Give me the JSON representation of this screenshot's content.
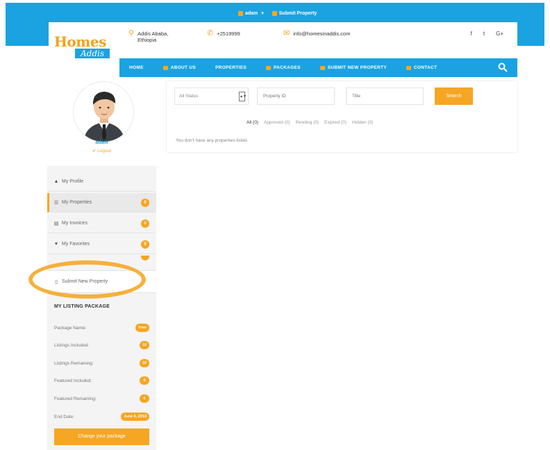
{
  "topbar": {
    "user": "adam",
    "submit": "Submit Property"
  },
  "logo": {
    "main": "Homes",
    "sub": "Addis"
  },
  "contact": {
    "address": "Addis Ababa, Ethiopia",
    "phone": "+2519999",
    "email": "info@homesinaddis.com"
  },
  "social": [
    "f",
    "t",
    "G+"
  ],
  "nav": [
    {
      "label": "HOME",
      "icon": null
    },
    {
      "label": "ABOUT US",
      "icon": "info-icon"
    },
    {
      "label": "PROPERTIES",
      "icon": null
    },
    {
      "label": "PACKAGES",
      "icon": "package-icon"
    },
    {
      "label": "SUBMIT NEW PROPERTY",
      "icon": "plus-icon"
    },
    {
      "label": "CONTACT",
      "icon": "contact-icon"
    }
  ],
  "profile": {
    "name": "adam",
    "logout": "Logout"
  },
  "menu": [
    {
      "label": "My Profile",
      "icon": "user-icon",
      "count": ""
    },
    {
      "label": "My Properties",
      "icon": "list-icon",
      "count": "0"
    },
    {
      "label": "My Invoices",
      "icon": "invoice-icon",
      "count": "0"
    },
    {
      "label": "My Favorites",
      "icon": "heart-icon",
      "count": "0"
    },
    {
      "label": "Submit New Property",
      "icon": "document-icon",
      "count": ""
    }
  ],
  "package": {
    "title": "MY LISTING PACKAGE",
    "rows": [
      {
        "label": "Package Name:",
        "value": "Free"
      },
      {
        "label": "Listings Included:",
        "value": "10"
      },
      {
        "label": "Listings Remaining:",
        "value": "10"
      },
      {
        "label": "Featured Included:",
        "value": "0"
      },
      {
        "label": "Featured Remaining:",
        "value": "0"
      },
      {
        "label": "End Date:",
        "value": "June 5, 2019"
      }
    ],
    "button": "Change your package"
  },
  "filters": {
    "status": "All Status",
    "property_id_placeholder": "Property ID",
    "title_placeholder": "Title",
    "search": "Search",
    "tabs": [
      "All (0)",
      "Approved (0)",
      "Pending (0)",
      "Expired (0)",
      "Hidden (0)"
    ],
    "empty": "You don't have any properties listed."
  },
  "colors": {
    "primary": "#1aa3e0",
    "accent": "#f5a623"
  }
}
